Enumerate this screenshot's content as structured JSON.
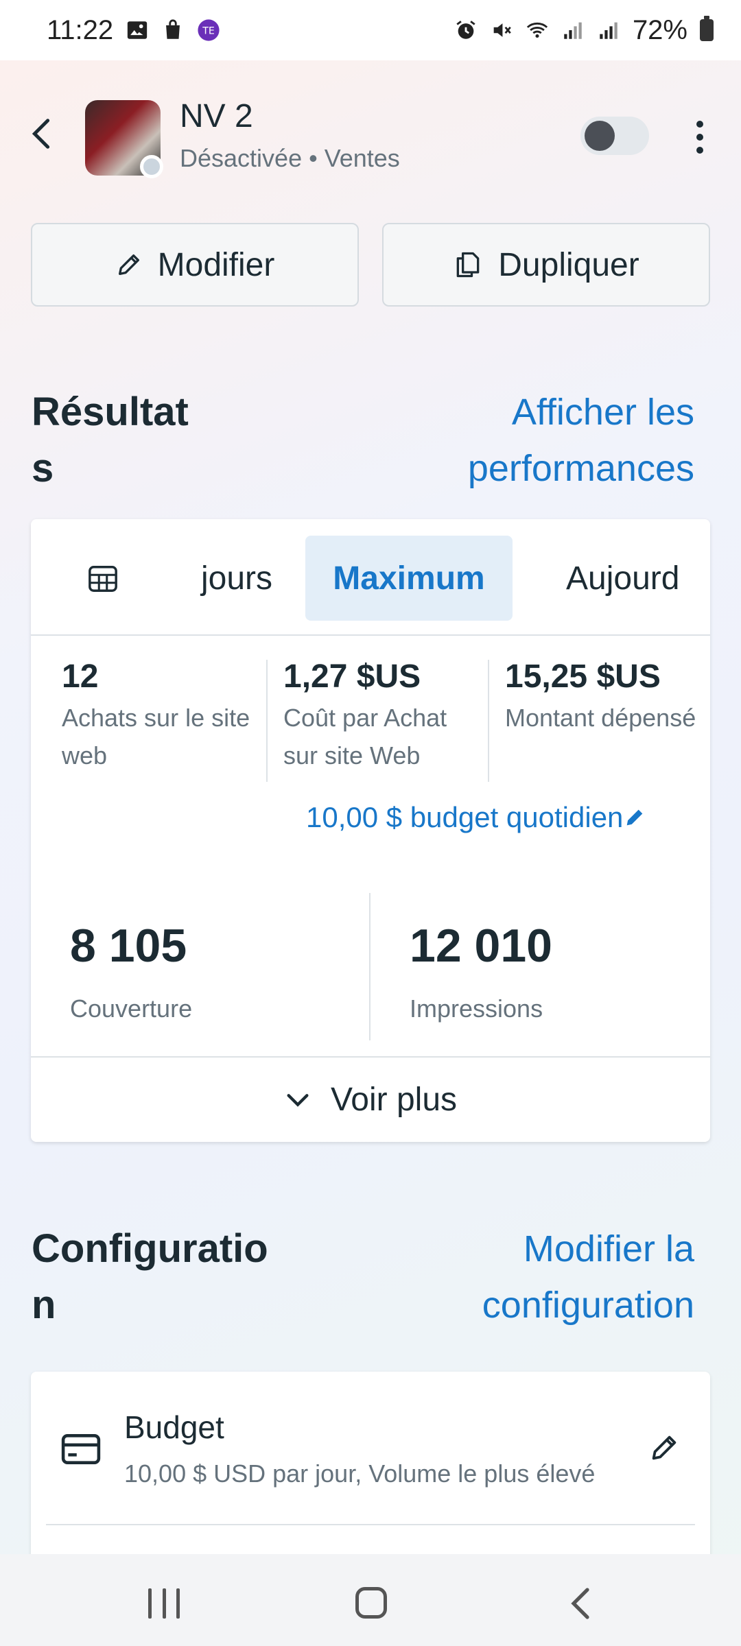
{
  "status_bar": {
    "time": "11:22",
    "battery": "72%",
    "left_icons": [
      "image-icon",
      "shopping-bag-icon",
      "app-badge-icon"
    ],
    "right_icons": [
      "alarm-icon",
      "mute-icon",
      "wifi-icon",
      "signal-icon",
      "signal-icon",
      "battery-icon"
    ]
  },
  "header": {
    "title": "NV 2",
    "subtitle": "Désactivée • Ventes",
    "toggle_on": false
  },
  "actions": {
    "modifier_label": "Modifier",
    "dupliquer_label": "Dupliquer"
  },
  "results": {
    "title": "Résultat\ns",
    "link": "Afficher les performances",
    "tabs": [
      {
        "label": "jours",
        "active": false
      },
      {
        "label": "Maximum",
        "active": true
      },
      {
        "label": "Aujourd",
        "active": false
      }
    ],
    "metrics": [
      {
        "value": "12",
        "label": "Achats sur le site web"
      },
      {
        "value": "1,27 $US",
        "label": "Coût par Achat sur site Web"
      },
      {
        "value": "15,25 $US",
        "label": "Montant dépensé"
      }
    ],
    "budget_link": "10,00 $ budget quotidien",
    "big_metrics": [
      {
        "value": "8 105",
        "label": "Couverture"
      },
      {
        "value": "12 010",
        "label": "Impressions"
      }
    ],
    "voir_plus": "Voir plus"
  },
  "configuration": {
    "title": "Configuratio\nn",
    "link": "Modifier la configuration",
    "budget": {
      "title": "Budget",
      "description": "10,00 $ USD par jour, Volume le plus élevé"
    }
  },
  "colors": {
    "accent": "#1877c9",
    "active_tab_bg": "#e3eef8",
    "text": "#1c2b33",
    "muted": "#65727c"
  }
}
